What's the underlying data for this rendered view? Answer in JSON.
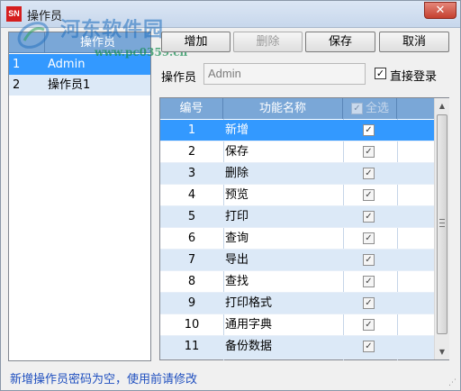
{
  "window": {
    "title": "操作员",
    "app_icon_text": "SN",
    "close_glyph": "✕"
  },
  "watermark": {
    "text": "河东软件园",
    "url": "www.pc0359.cn"
  },
  "operator_list": {
    "header": "操作员",
    "rows": [
      {
        "num": "1",
        "name": "Admin",
        "selected": true
      },
      {
        "num": "2",
        "name": "操作员1",
        "selected": false
      }
    ]
  },
  "toolbar": {
    "add": "增加",
    "delete": "删除",
    "save": "保存",
    "cancel": "取消"
  },
  "form": {
    "operator_label": "操作员",
    "operator_value": "Admin",
    "direct_login_label": "直接登录",
    "direct_login_checked": true
  },
  "grid": {
    "header_num": "编号",
    "header_name": "功能名称",
    "header_select_all": "全选",
    "rows": [
      {
        "num": "1",
        "name": "新增"
      },
      {
        "num": "2",
        "name": "保存"
      },
      {
        "num": "3",
        "name": "删除"
      },
      {
        "num": "4",
        "name": "预览"
      },
      {
        "num": "5",
        "name": "打印"
      },
      {
        "num": "6",
        "name": "查询"
      },
      {
        "num": "7",
        "name": "导出"
      },
      {
        "num": "8",
        "name": "查找"
      },
      {
        "num": "9",
        "name": "打印格式"
      },
      {
        "num": "10",
        "name": "通用字典"
      },
      {
        "num": "11",
        "name": "备份数据"
      }
    ],
    "check_glyph": "✓"
  },
  "scrollbar": {
    "up_glyph": "▲",
    "down_glyph": "▼"
  },
  "status_text": "新增操作员密码为空，使用前请修改",
  "colors": {
    "selection": "#3399ff",
    "header": "#7aa7d7",
    "alt_row": "#dce9f7",
    "status_text": "#1f4fbf"
  }
}
